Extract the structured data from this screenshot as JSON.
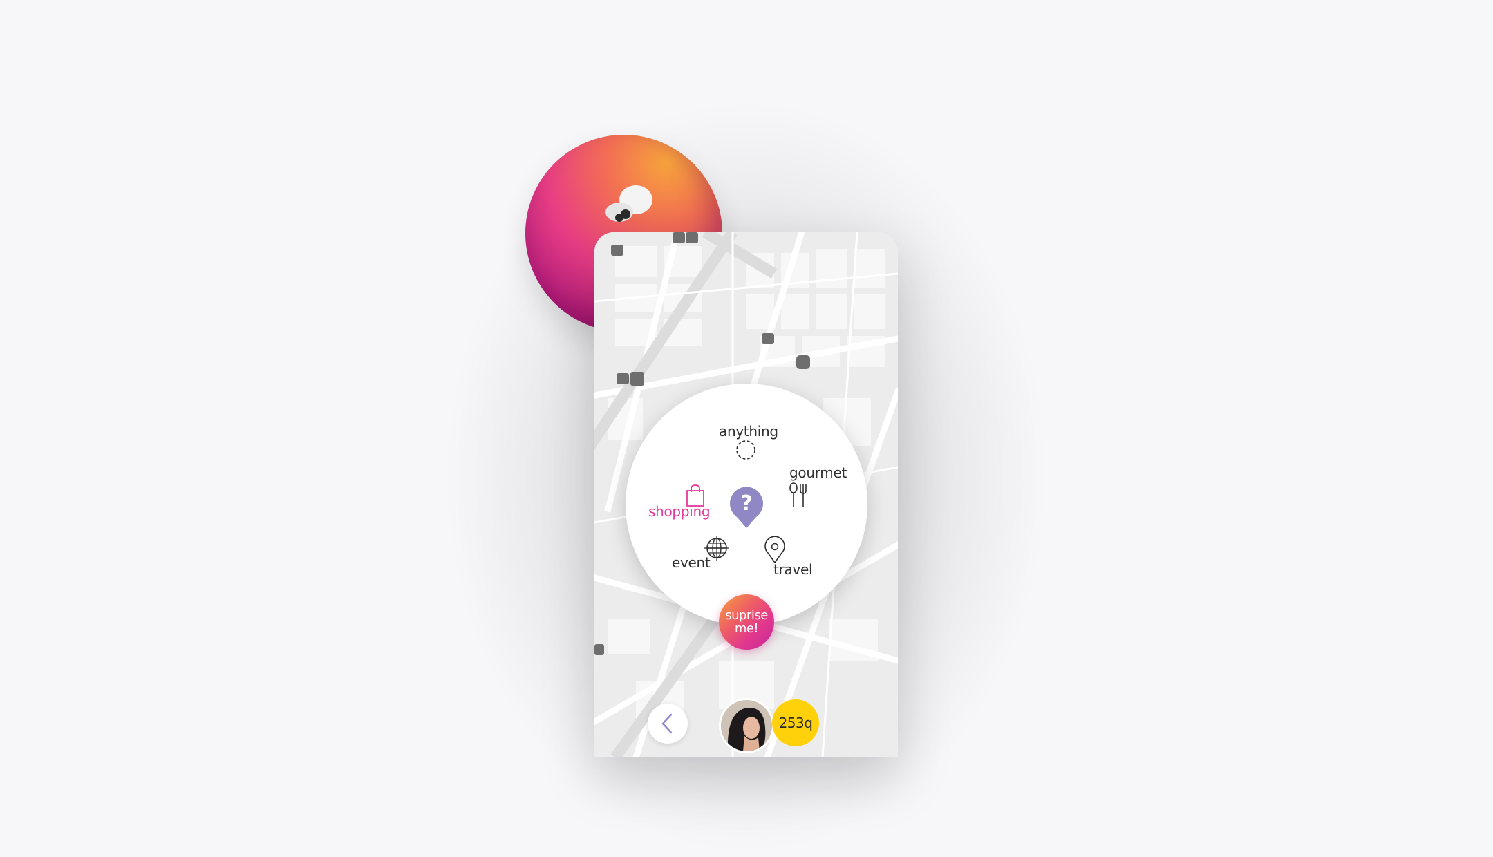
{
  "menu": {
    "center_symbol": "?",
    "options": [
      {
        "id": "anything",
        "label": "anything",
        "icon": "dashed-circle-icon"
      },
      {
        "id": "gourmet",
        "label": "gourmet",
        "icon": "fork-spoon-icon"
      },
      {
        "id": "shopping",
        "label": "shopping",
        "icon": "shopping-bag-icon",
        "selected": true
      },
      {
        "id": "event",
        "label": "event",
        "icon": "globe-icon"
      },
      {
        "id": "travel",
        "label": "travel",
        "icon": "location-pin-icon"
      }
    ],
    "surprise_label": "suprise me!"
  },
  "bottom_bar": {
    "back_icon": "chevron-left-icon",
    "coins": "253q"
  },
  "colors": {
    "accent_pink": "#e5389a",
    "pin_purple": "#8f88c4",
    "coin_yellow": "#ffd10a"
  }
}
